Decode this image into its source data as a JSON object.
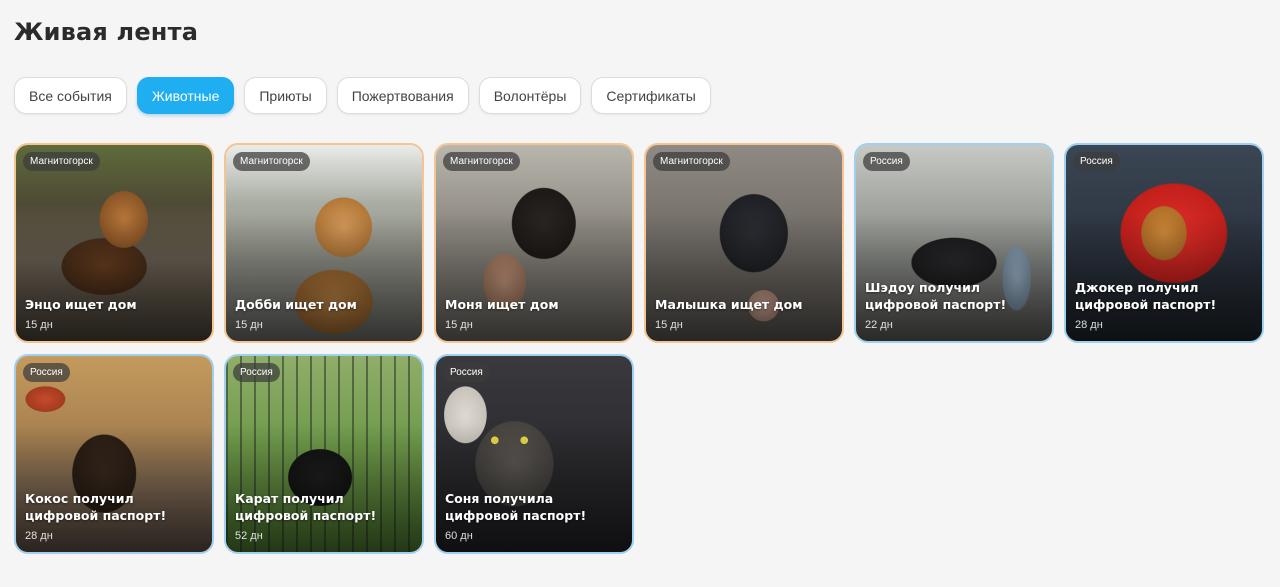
{
  "page": {
    "title": "Живая лента"
  },
  "tabs": [
    {
      "label": "Все события",
      "active": false
    },
    {
      "label": "Животные",
      "active": true
    },
    {
      "label": "Приюты",
      "active": false
    },
    {
      "label": "Пожертвования",
      "active": false
    },
    {
      "label": "Волонтёры",
      "active": false
    },
    {
      "label": "Сертификаты",
      "active": false
    }
  ],
  "colors": {
    "accent": "#1faef0",
    "card_border_search": "#f4c592",
    "card_border_passport": "#9fd0ef"
  },
  "cards": [
    {
      "location": "Магнитогорск",
      "title": "Энцо ищет дом",
      "date": "15 дн"
    },
    {
      "location": "Магнитогорск",
      "title": "Добби ищет дом",
      "date": "15 дн"
    },
    {
      "location": "Магнитогорск",
      "title": "Моня ищет дом",
      "date": "15 дн"
    },
    {
      "location": "Магнитогорск",
      "title": "Малышка ищет дом",
      "date": "15 дн"
    },
    {
      "location": "Россия",
      "title": "Шэдоу получил цифровой паспорт!",
      "date": "22 дн"
    },
    {
      "location": "Россия",
      "title": "Джокер получил цифровой паспорт!",
      "date": "28 дн"
    },
    {
      "location": "Россия",
      "title": "Кокос получил цифровой паспорт!",
      "date": "28 дн"
    },
    {
      "location": "Россия",
      "title": "Карат получил цифровой паспорт!",
      "date": "52 дн"
    },
    {
      "location": "Россия",
      "title": "Соня получила цифровой паспорт!",
      "date": "60 дн"
    }
  ]
}
